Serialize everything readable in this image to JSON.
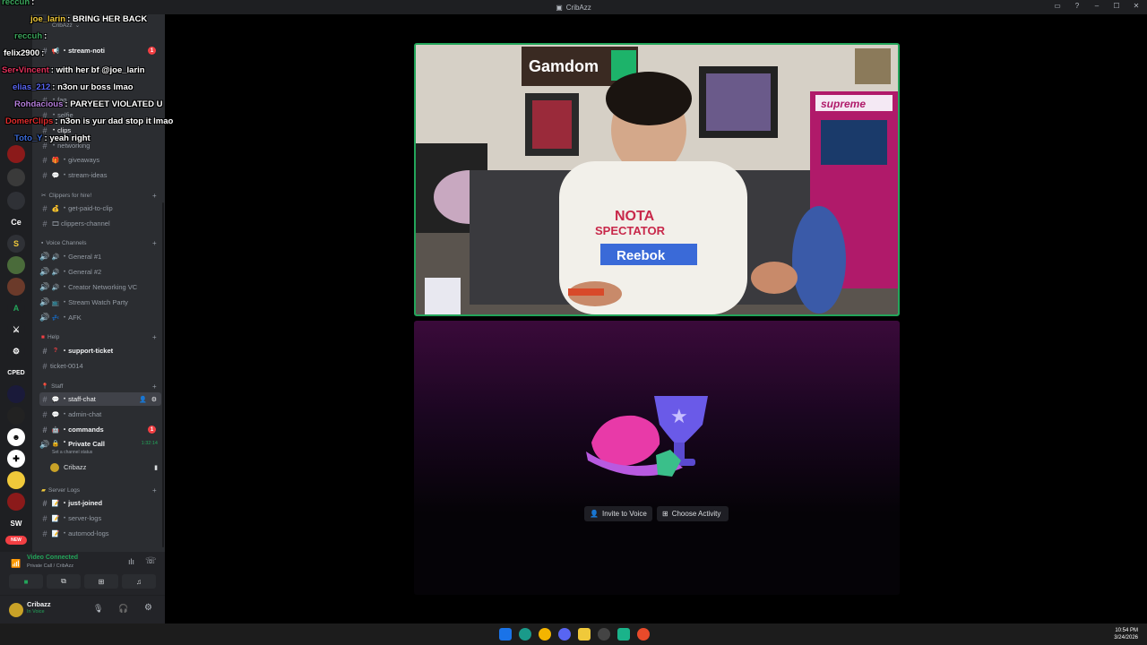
{
  "window": {
    "title": "CribAzz",
    "controls": [
      "▭",
      "?",
      "–",
      "☐",
      "✕"
    ]
  },
  "server_rail": {
    "labels": {
      "ce": "Ce",
      "s": "S",
      "a": "A",
      "cped": "CPED",
      "sw": "SW",
      "new": "NEW"
    }
  },
  "sidebar": {
    "server_name": "CribAzz",
    "top_channels": [
      {
        "name": "stream-noti",
        "badge": "1"
      },
      {
        "name": "faq"
      },
      {
        "name": "selfie"
      },
      {
        "name": "clips"
      },
      {
        "name": "networking"
      }
    ],
    "channels_a": [
      {
        "name": "giveaways"
      },
      {
        "name": "stream-ideas"
      }
    ],
    "category_clippers": "Clippers for hire!",
    "channels_clippers": [
      {
        "name": "get-paid-to-clip"
      },
      {
        "name": "clippers-channel"
      }
    ],
    "category_voice": "Voice Channels",
    "voice_channels": [
      {
        "name": "General #1"
      },
      {
        "name": "General #2"
      },
      {
        "name": "Creator Networking VC"
      },
      {
        "name": "Stream Watch Party"
      },
      {
        "name": "AFK"
      }
    ],
    "category_help": "Help",
    "help_channels": [
      {
        "name": "support-ticket"
      },
      {
        "name": "ticket-0014"
      }
    ],
    "category_staff": "Staff",
    "staff_channels": [
      {
        "name": "staff-chat"
      },
      {
        "name": "admin-chat"
      },
      {
        "name": "commands",
        "badge": "1"
      }
    ],
    "private_call": {
      "name": "Private Call",
      "timer": "1:32:14",
      "status": "Set a channel status",
      "member": "Cribazz"
    },
    "category_logs": "Server Logs",
    "log_channels": [
      {
        "name": "just-joined"
      },
      {
        "name": "server-logs"
      },
      {
        "name": "automod-logs"
      }
    ]
  },
  "voice_panel": {
    "status": "Video Connected",
    "location": "Private Call / CribAzz"
  },
  "user_panel": {
    "username": "Cribazz",
    "status": "In Voice"
  },
  "activity": {
    "invite_label": "Invite to Voice",
    "choose_label": "Choose Activity"
  },
  "stream": {
    "sign_brand": "Gamdom",
    "shirt_line1": "NOTA",
    "shirt_line2": "SPECTATOR",
    "shirt_brand": "Reebok",
    "arcade_text": "supreme"
  },
  "chat_overlay": [
    {
      "user": "reccuh",
      "text": "",
      "color": "#3ba55c"
    },
    {
      "user": "joe_larin",
      "text": "BRING HER BACK",
      "color": "#f0c93a"
    },
    {
      "user": "reccuh",
      "text": "",
      "color": "#3ba55c"
    },
    {
      "user": "felix2900",
      "text": "",
      "color": "#ffffff"
    },
    {
      "user": "Ser•Vincent",
      "text": "with her bf @joe_larin",
      "color": "#e0315b"
    },
    {
      "user": "elias_212",
      "text": "n3on ur boss lmao",
      "color": "#5865f2"
    },
    {
      "user": "Rohdacious",
      "text": "PARYEET VIOLATED U",
      "color": "#b57edc"
    },
    {
      "user": "DomerClips",
      "text": "n3on is yur dad stop it lmao",
      "color": "#e02d2d"
    },
    {
      "user": "Toto_Y",
      "text": "yeah right",
      "color": "#3b6bd8"
    }
  ],
  "clock": {
    "time": "10:54 PM",
    "date": "3/24/2026"
  },
  "colors": {
    "accent_green": "#23a55a",
    "discord_bg": "#2b2d31",
    "rail_bg": "#1e1f22"
  }
}
